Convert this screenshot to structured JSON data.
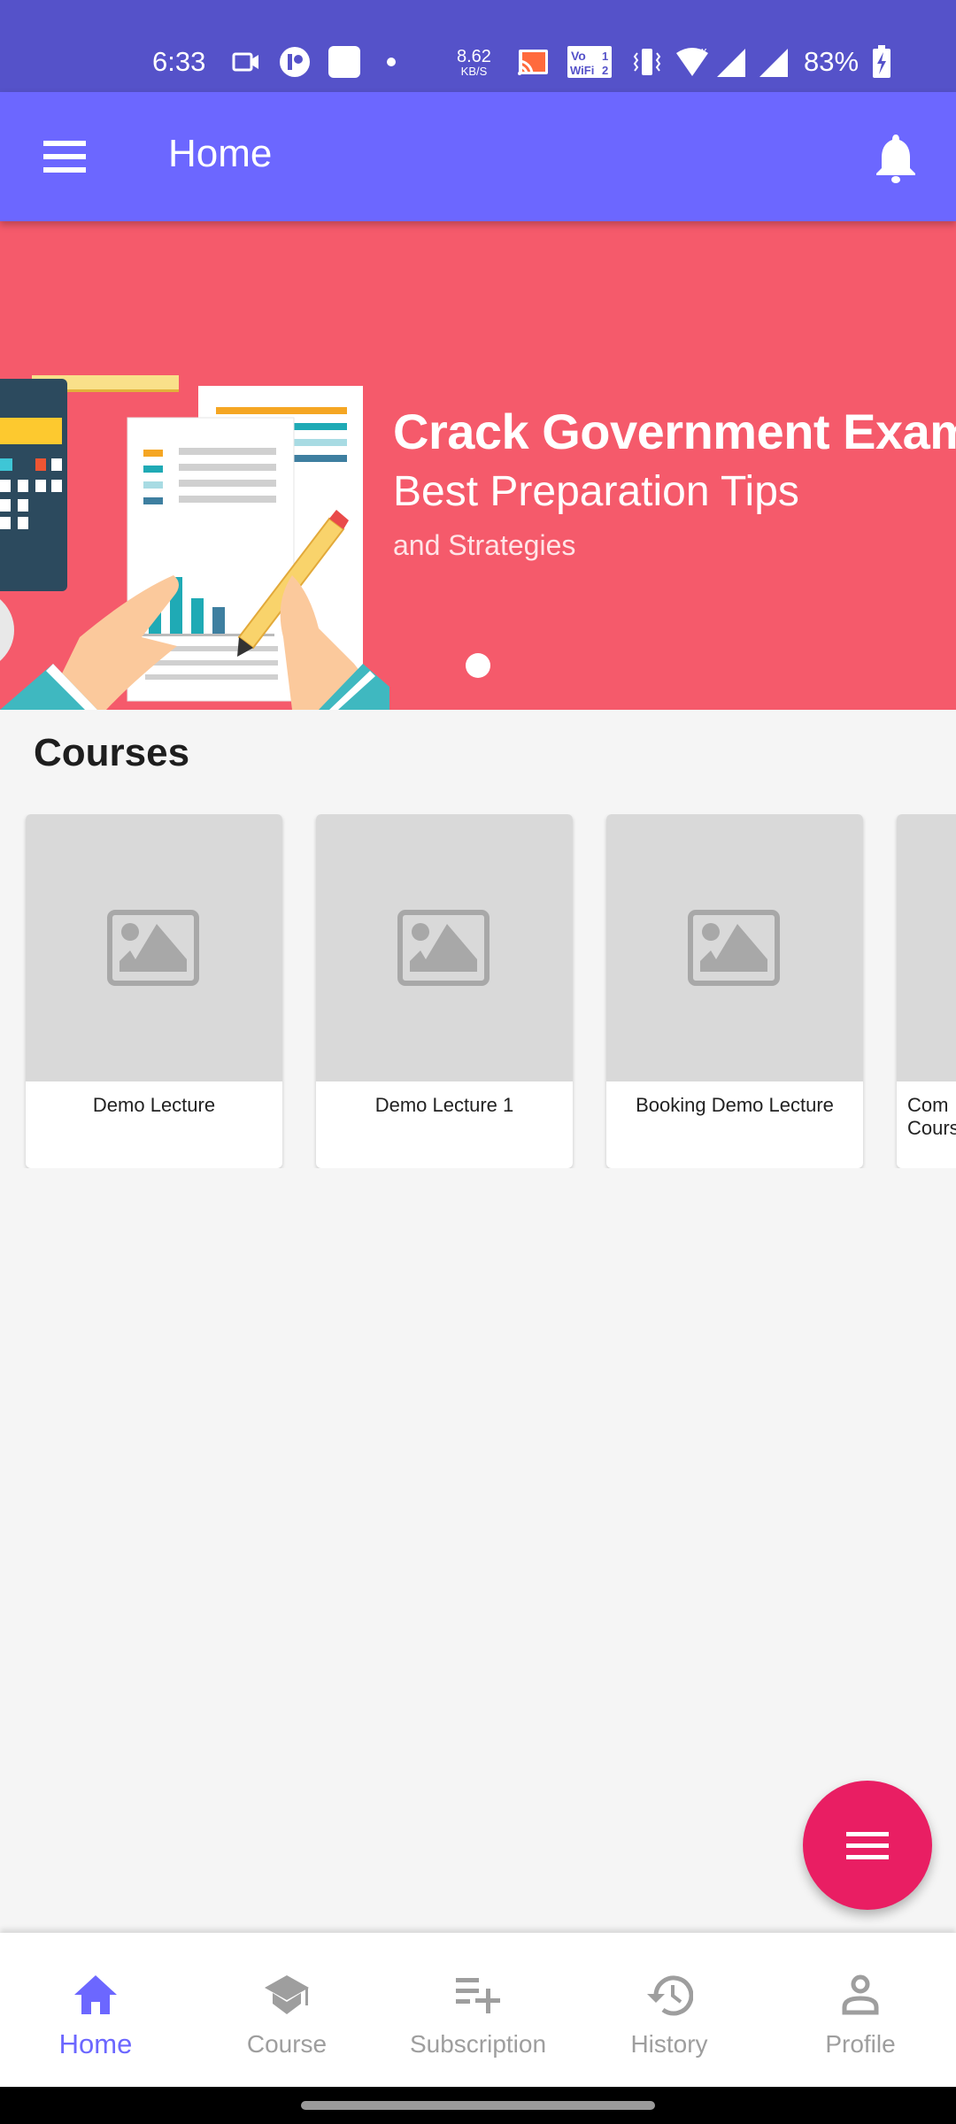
{
  "status_bar": {
    "time": "6:33",
    "net_speed_value": "8.62",
    "net_speed_unit": "KB/S",
    "vowifi_label": "Vo WiFi",
    "battery_percent": "83%",
    "icons": [
      "video-camera-icon",
      "app-notification-icon",
      "app-notification-icon",
      "dot-icon",
      "cast-icon",
      "vowifi-icon",
      "vibrate-icon",
      "wifi-icon",
      "signal-icon",
      "signal-icon",
      "battery-charging-icon"
    ]
  },
  "app_bar": {
    "title": "Home",
    "menu_icon": "hamburger-menu-icon",
    "notification_icon": "bell-icon",
    "color": "#6c67ff"
  },
  "banner": {
    "headline": "Crack Government Exams",
    "subheadline": "Best Preparation Tips",
    "tagline": "and Strategies",
    "background_color": "#f55a6b",
    "slide_count_visible": 1,
    "active_slide": 1
  },
  "courses": {
    "section_title": "Courses",
    "items": [
      {
        "name": "Demo Lecture",
        "thumbnail": "image-placeholder-icon"
      },
      {
        "name": "Demo Lecture 1",
        "thumbnail": "image-placeholder-icon"
      },
      {
        "name": "Booking Demo Lecture",
        "thumbnail": "image-placeholder-icon"
      },
      {
        "name": "Com\nCours",
        "thumbnail": "image-placeholder-icon"
      }
    ]
  },
  "fab": {
    "icon": "menu-icon",
    "color": "#e91e63"
  },
  "bottom_nav": {
    "active_color": "#6c67ff",
    "inactive_color": "#9e9e9e",
    "items": [
      {
        "label": "Home",
        "icon": "home-icon",
        "active": true
      },
      {
        "label": "Course",
        "icon": "school-icon",
        "active": false
      },
      {
        "label": "Subscription",
        "icon": "playlist-add-icon",
        "active": false
      },
      {
        "label": "History",
        "icon": "history-icon",
        "active": false
      },
      {
        "label": "Profile",
        "icon": "person-icon",
        "active": false
      }
    ]
  }
}
